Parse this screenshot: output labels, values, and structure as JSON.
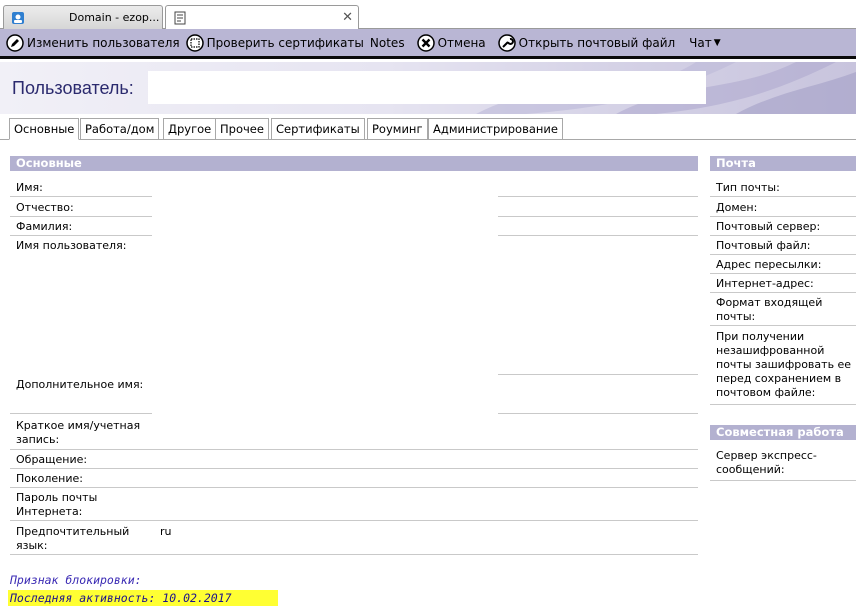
{
  "window_tabs": [
    {
      "title": "Domain - ezop...",
      "icon": "domain-icon"
    },
    {
      "title": "",
      "icon": "document-icon"
    }
  ],
  "toolbar": {
    "edit_user": "Изменить пользователя",
    "check_certs": "Проверить сертификаты",
    "notes": "Notes",
    "cancel": "Отмена",
    "open_mail_file": "Открыть почтовый файл",
    "chat": "Чат"
  },
  "header": {
    "title": "Пользователь:",
    "value": ""
  },
  "form_tabs": [
    "Основные",
    "Работа/дом",
    "Другое",
    "Прочее",
    "Сертификаты",
    "Роуминг",
    "Администрирование"
  ],
  "basic": {
    "heading": "Основные",
    "first_name": "Имя:",
    "middle_name": "Отчество:",
    "last_name": "Фамилия:",
    "user_name": "Имя пользователя:",
    "alt_name": "Дополнительное имя:",
    "short_name": "Краткое имя/учетная запись:",
    "title": "Обращение:",
    "generation": "Поколение:",
    "internet_password": "Пароль почты Интернета:",
    "preferred_language": "Предпочтительный язык:",
    "preferred_language_value": "ru"
  },
  "mail": {
    "heading": "Почта",
    "mail_type": "Тип почты:",
    "domain": "Домен:",
    "mail_server": "Почтовый сервер:",
    "mail_file": "Почтовый файл:",
    "forwarding": "Адрес пересылки:",
    "internet_address": "Интернет-адрес:",
    "incoming_format": "Формат входящей почты:",
    "encrypt_incoming": "При получении незашифрованной почты зашифровать ее перед сохранением в почтовом файле:"
  },
  "collab": {
    "heading": "Совместная работа",
    "sametime_server": "Сервер экспресс-сообщений:"
  },
  "footer": {
    "lock_status": "Признак блокировки:",
    "last_activity": "Последняя активность: 10.02.2017"
  }
}
